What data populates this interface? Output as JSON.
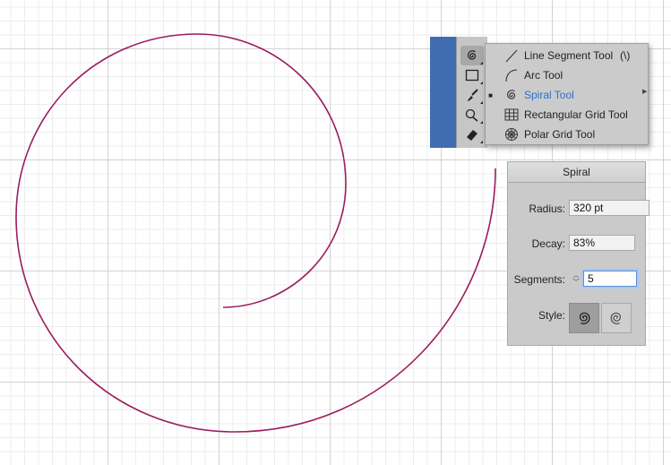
{
  "colors": {
    "spiral_stroke": "#9b1c5e",
    "accent": "#2a6fd1"
  },
  "toolbar": {
    "tools": [
      {
        "icon": "spiral-icon",
        "active": true
      },
      {
        "icon": "rectangle-icon",
        "active": false
      },
      {
        "icon": "paintbrush-icon",
        "active": false
      },
      {
        "icon": "shaper-icon",
        "active": false
      },
      {
        "icon": "eraser-icon",
        "active": false
      }
    ]
  },
  "flyout": {
    "items": [
      {
        "label": "Line Segment Tool",
        "shortcut": "(\\)",
        "icon": "line-segment-icon",
        "selected": false
      },
      {
        "label": "Arc Tool",
        "shortcut": "",
        "icon": "arc-icon",
        "selected": false
      },
      {
        "label": "Spiral Tool",
        "shortcut": "",
        "icon": "spiral-icon",
        "selected": true,
        "check": "■"
      },
      {
        "label": "Rectangular Grid Tool",
        "shortcut": "",
        "icon": "rectangular-grid-icon",
        "selected": false
      },
      {
        "label": "Polar Grid Tool",
        "shortcut": "",
        "icon": "polar-grid-icon",
        "selected": false
      }
    ]
  },
  "dialog": {
    "title": "Spiral",
    "radius_label": "Radius:",
    "radius_value": "320 pt",
    "decay_label": "Decay:",
    "decay_value": "83%",
    "segments_label": "Segments:",
    "segments_value": "5",
    "style_label": "Style:",
    "style_options": [
      "counterclockwise-spiral-icon",
      "clockwise-spiral-icon"
    ],
    "style_selected": "counterclockwise-spiral-icon"
  }
}
